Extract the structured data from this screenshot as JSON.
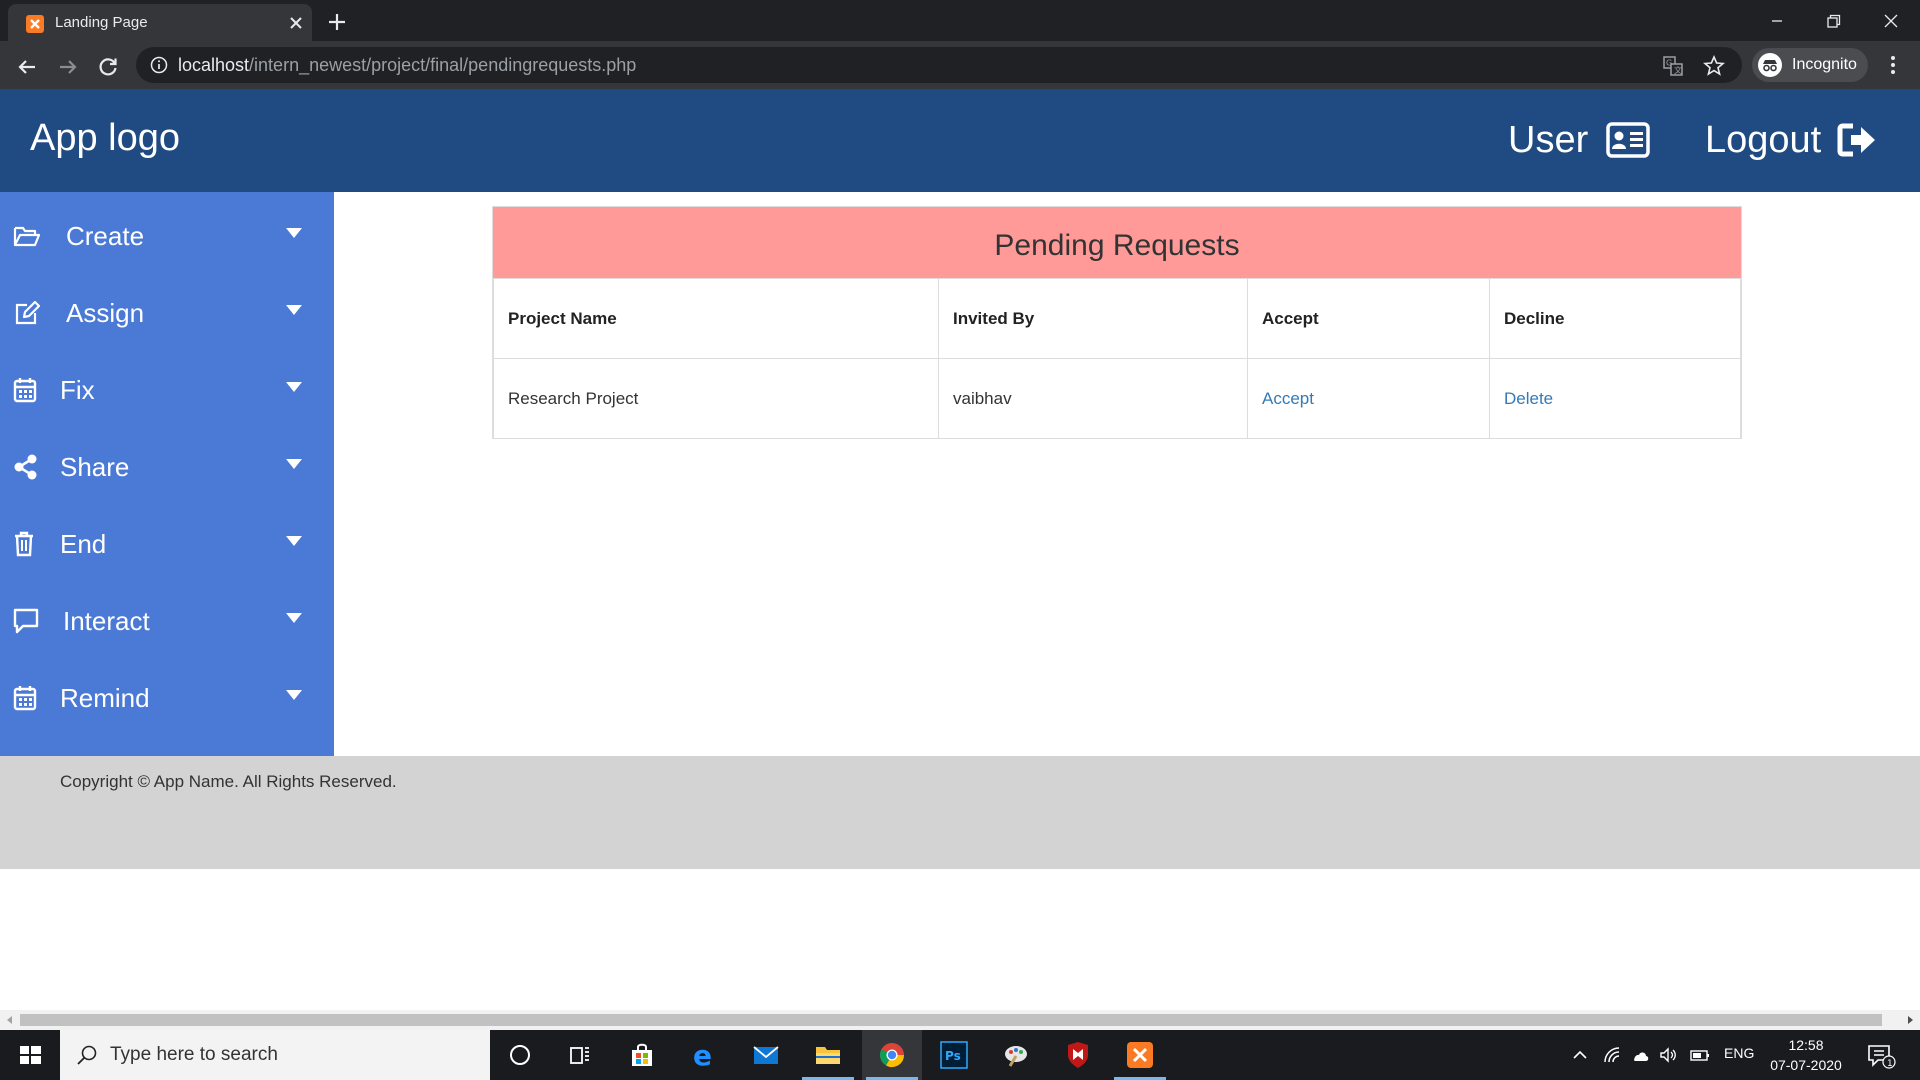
{
  "browser": {
    "tab_title": "Landing Page",
    "url_host": "localhost",
    "url_path": "/intern_newest/project/final/pendingrequests.php",
    "profile_label": "Incognito"
  },
  "header": {
    "logo": "App logo",
    "user_label": "User",
    "logout_label": "Logout",
    "background": "#1f4a82"
  },
  "sidebar": {
    "background": "#4b79d6",
    "items": [
      {
        "label": "Create",
        "icon": "folder-open-icon"
      },
      {
        "label": "Assign",
        "icon": "edit-icon"
      },
      {
        "label": "Fix",
        "icon": "calendar-icon"
      },
      {
        "label": "Share",
        "icon": "share-icon"
      },
      {
        "label": "End",
        "icon": "trash-icon"
      },
      {
        "label": "Interact",
        "icon": "comment-icon"
      },
      {
        "label": "Remind",
        "icon": "calendar-icon"
      }
    ]
  },
  "pending": {
    "title": "Pending Requests",
    "title_bg": "#ff9a99",
    "columns": [
      "Project Name",
      "Invited By",
      "Accept",
      "Decline"
    ],
    "rows": [
      {
        "project": "Research Project",
        "invited_by": "vaibhav",
        "accept": "Accept",
        "decline": "Delete"
      }
    ]
  },
  "footer": {
    "copyright": "Copyright © App Name. All Rights Reserved."
  },
  "taskbar": {
    "search_placeholder": "Type here to search",
    "language": "ENG",
    "time": "12:58",
    "date": "07-07-2020"
  }
}
